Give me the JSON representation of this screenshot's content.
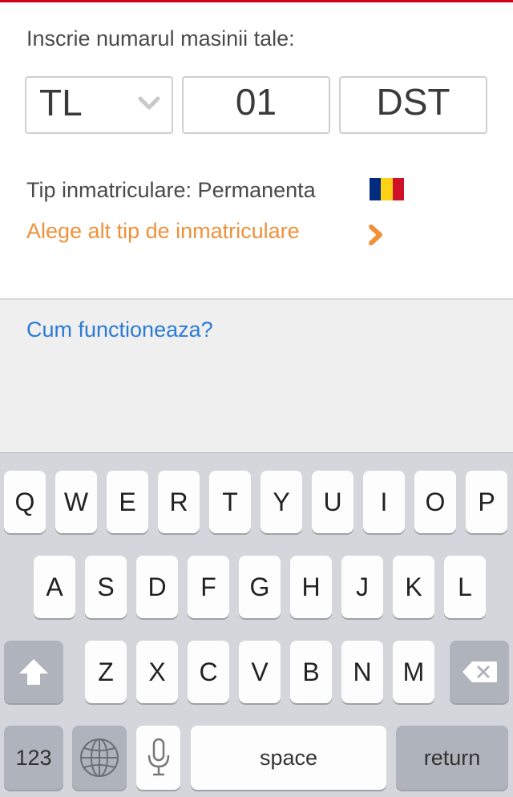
{
  "form": {
    "prompt": "Inscrie numarul masinii tale:",
    "county": "TL",
    "number": "01",
    "letters": "DST",
    "registration_type_label": "Tip inmatriculare: Permanenta",
    "change_type_link": "Alege alt tip de inmatriculare",
    "flag_colors": [
      "#002b7f",
      "#fcd116",
      "#ce1126"
    ]
  },
  "help": {
    "link": "Cum functioneaza?"
  },
  "keyboard": {
    "row1": [
      "Q",
      "W",
      "E",
      "R",
      "T",
      "Y",
      "U",
      "I",
      "O",
      "P"
    ],
    "row2": [
      "A",
      "S",
      "D",
      "F",
      "G",
      "H",
      "J",
      "K",
      "L"
    ],
    "row3": [
      "Z",
      "X",
      "C",
      "V",
      "B",
      "N",
      "M"
    ],
    "numbers_key": "123",
    "space_key": "space",
    "return_key": "return"
  },
  "colors": {
    "accent_red": "#d0021b",
    "link_orange": "#f0913a",
    "link_blue": "#2b7bd6"
  }
}
